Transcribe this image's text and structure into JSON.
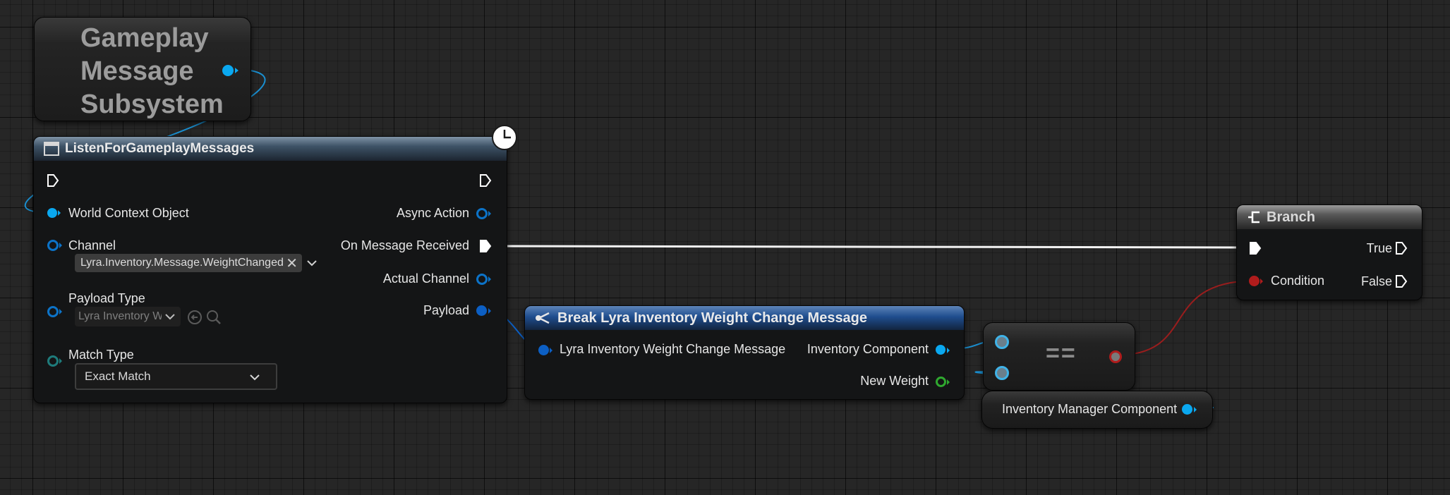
{
  "colors": {
    "background": "#262626",
    "object_pin": "#0aa8f0",
    "struct_pin": "#0c5fc4",
    "bool_pin": "#b01c1c",
    "float_pin": "#2fa82f",
    "exec_pin": "#ffffff",
    "equal_node_pin": "#3fb3e8"
  },
  "subsystem_node": {
    "title_lines": [
      "Gameplay",
      "Message",
      "Subsystem"
    ]
  },
  "listen_node": {
    "title": "ListenForGameplayMessages",
    "header_icon": "function-icon",
    "latent_icon": "clock-icon",
    "inputs": {
      "world_context": "World Context Object",
      "channel": "Channel",
      "channel_value": "Lyra.Inventory.Message.WeightChanged",
      "payload_type": "Payload Type",
      "payload_type_value": "Lyra Inventory W",
      "match_type": "Match Type",
      "match_type_value": "Exact Match"
    },
    "outputs": {
      "async_action": "Async Action",
      "on_message_received": "On Message Received",
      "actual_channel": "Actual Channel",
      "payload": "Payload"
    }
  },
  "break_node": {
    "title": "Break Lyra Inventory Weight Change Message",
    "input": "Lyra Inventory Weight Change Message",
    "outputs": {
      "inventory_component": "Inventory Component",
      "new_weight": "New Weight"
    }
  },
  "equal_node": {
    "symbol": "=="
  },
  "inventory_manager_node": {
    "label": "Inventory Manager Component"
  },
  "branch_node": {
    "title": "Branch",
    "condition": "Condition",
    "true_label": "True",
    "false_label": "False"
  }
}
